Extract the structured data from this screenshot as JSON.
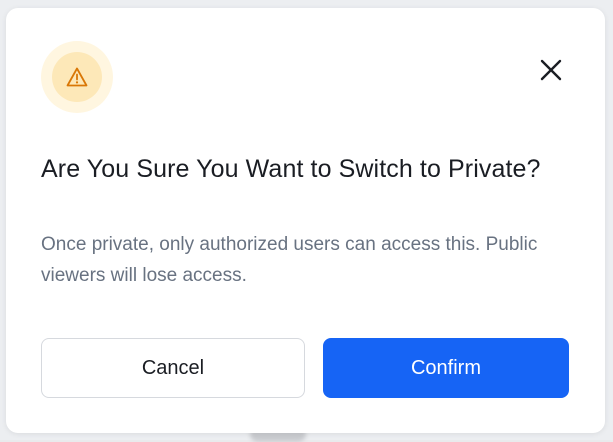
{
  "dialog": {
    "title": "Are You Sure You Want to Switch to Private?",
    "message": "Once private, only authorized users can access this. Public viewers will lose access.",
    "icon": "warning-icon",
    "close_icon": "close-icon",
    "cancel_label": "Cancel",
    "confirm_label": "Confirm"
  },
  "colors": {
    "accent": "#1664f5",
    "warning": "#d97706",
    "warning_bg": "#fde8b8"
  }
}
